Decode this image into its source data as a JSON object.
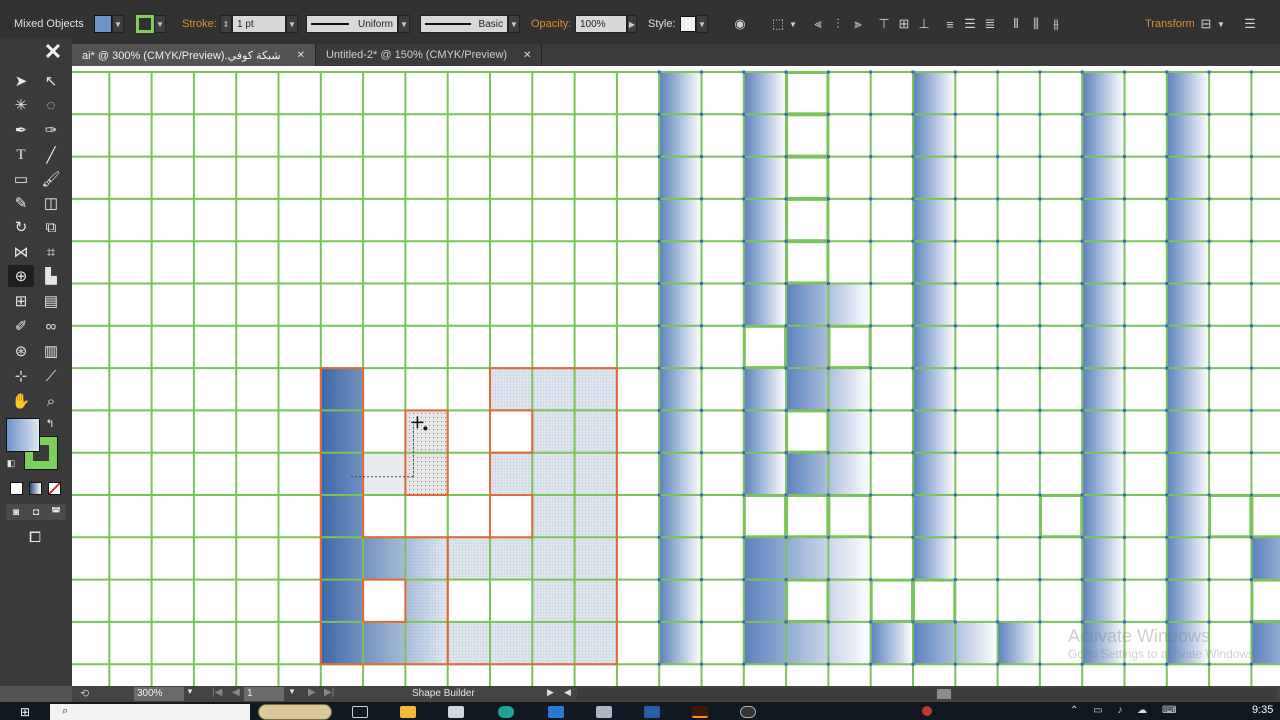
{
  "control_bar": {
    "selection_label": "Mixed Objects",
    "stroke_label": "Stroke:",
    "stroke_weight": "1 pt",
    "stroke_profile": "Uniform",
    "brush": "Basic",
    "opacity_label": "Opacity:",
    "opacity_value": "100%",
    "style_label": "Style:",
    "transform_label": "Transform",
    "colors": {
      "stroke_swatch": "#7cd05a",
      "fill_swatch": "#6e93c8",
      "accent": "#e08a2c"
    }
  },
  "tabs": [
    {
      "label": "شبكة كوفي.ai* @ 300% (CMYK/Preview)",
      "active": true
    },
    {
      "label": "Untitled-2* @ 150% (CMYK/Preview)",
      "active": false
    }
  ],
  "status_bar": {
    "zoom": "300%",
    "artboard": "1",
    "tool_name": "Shape Builder"
  },
  "taskbar": {
    "time": "9:35"
  },
  "watermark": {
    "line1": "Activate Windows",
    "line2": "Go to Settings to activate Windows."
  }
}
